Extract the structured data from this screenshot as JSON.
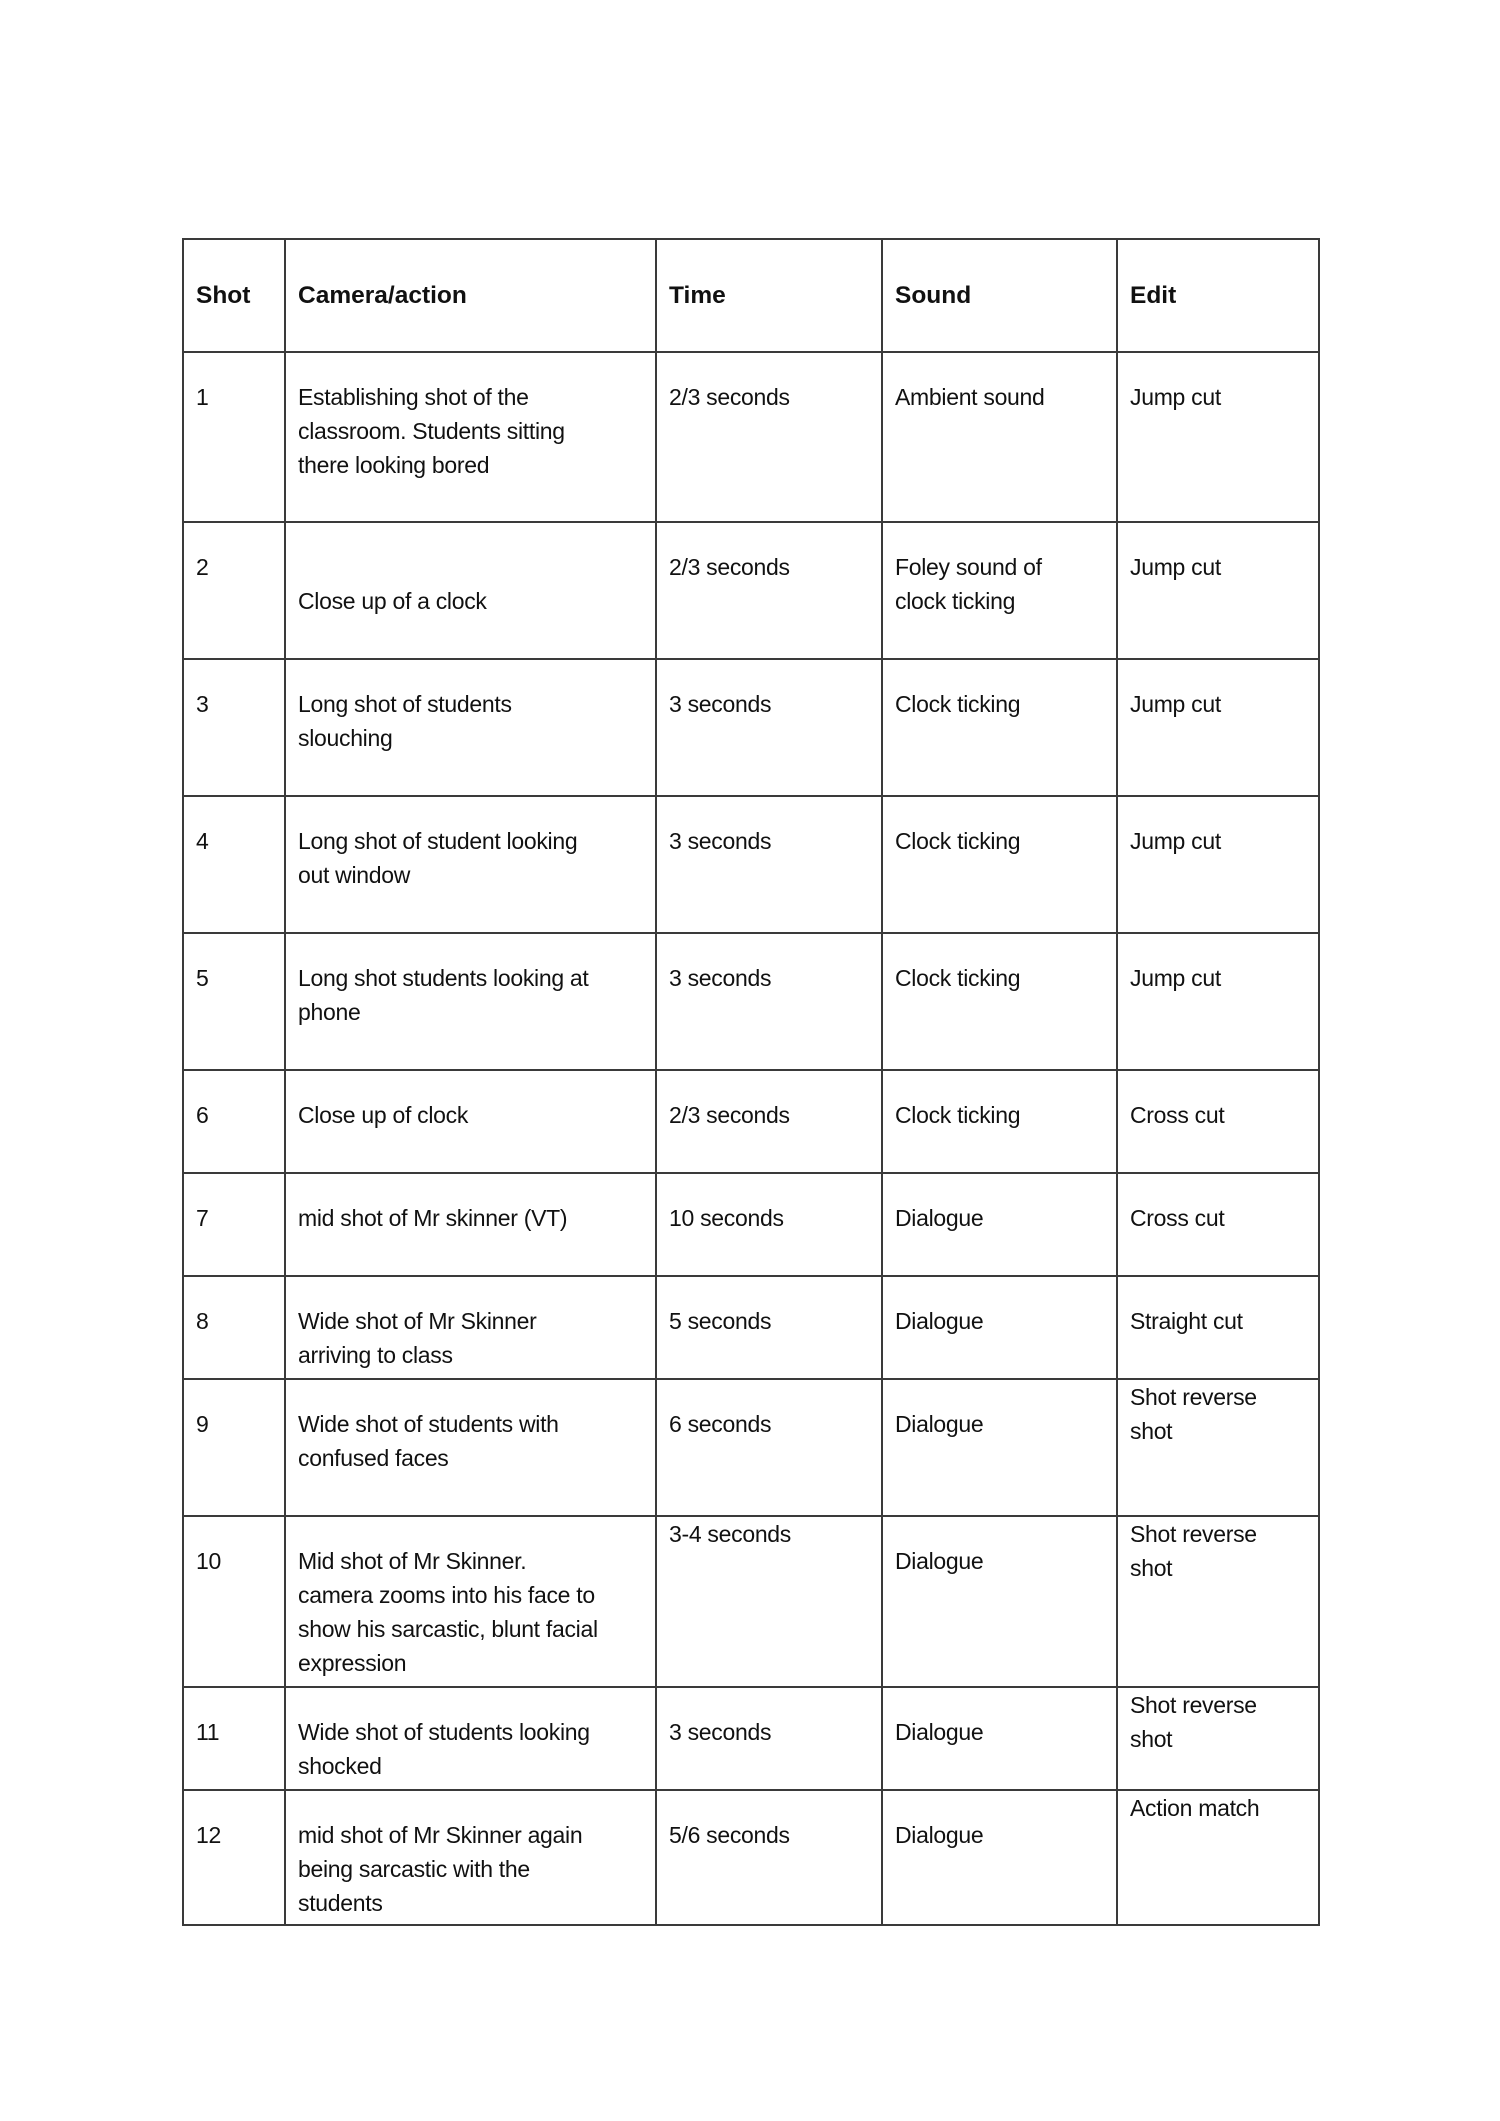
{
  "document": {
    "headers": [
      "Shot",
      "Camera/action",
      "Time",
      "Sound",
      "Edit"
    ],
    "rows": [
      {
        "shot": "1",
        "camera_action": [
          "Establishing shot of the",
          "classroom. Students sitting",
          "there looking bored"
        ],
        "time": [
          "2/3 seconds"
        ],
        "sound": [
          "Ambient sound"
        ],
        "edit": [
          "Jump cut"
        ]
      },
      {
        "shot": "2",
        "camera_action": [
          "Close up of a clock"
        ],
        "time": [
          "2/3 seconds"
        ],
        "sound": [
          "Foley sound of",
          "clock ticking"
        ],
        "edit": [
          "Jump cut"
        ]
      },
      {
        "shot": "3",
        "camera_action": [
          "Long shot of students",
          "slouching"
        ],
        "time": [
          "3 seconds"
        ],
        "sound": [
          "Clock ticking"
        ],
        "edit": [
          "Jump cut"
        ]
      },
      {
        "shot": "4",
        "camera_action": [
          "Long shot of student looking",
          "out window"
        ],
        "time": [
          "3 seconds"
        ],
        "sound": [
          "Clock ticking"
        ],
        "edit": [
          "Jump cut"
        ]
      },
      {
        "shot": "5",
        "camera_action": [
          "Long shot students looking at",
          "phone"
        ],
        "time": [
          "3 seconds"
        ],
        "sound": [
          "Clock ticking"
        ],
        "edit": [
          "Jump cut"
        ]
      },
      {
        "shot": "6",
        "camera_action": [
          "Close up of clock"
        ],
        "time": [
          "2/3 seconds"
        ],
        "sound": [
          "Clock ticking"
        ],
        "edit": [
          "Cross cut"
        ]
      },
      {
        "shot": "7",
        "camera_action": [
          "mid shot of Mr skinner (VT)"
        ],
        "time": [
          "10 seconds"
        ],
        "sound": [
          "Dialogue"
        ],
        "edit": [
          "Cross cut"
        ]
      },
      {
        "shot": "8",
        "camera_action": [
          "Wide shot of Mr Skinner",
          "arriving to class"
        ],
        "time": [
          "5 seconds"
        ],
        "sound": [
          "Dialogue"
        ],
        "edit": [
          "Straight cut"
        ]
      },
      {
        "shot": "9",
        "camera_action": [
          "Wide shot of students with",
          "confused faces"
        ],
        "time": [
          "6 seconds"
        ],
        "sound": [
          "Dialogue"
        ],
        "edit": [
          "Shot reverse",
          "shot"
        ]
      },
      {
        "shot": "10",
        "camera_action": [
          "Mid shot of Mr Skinner.",
          "camera zooms into his face to",
          "show his sarcastic, blunt facial",
          "expression"
        ],
        "time": [
          "3-4 seconds"
        ],
        "sound": [
          "Dialogue"
        ],
        "edit": [
          "Shot reverse",
          "shot"
        ]
      },
      {
        "shot": "11",
        "camera_action": [
          "Wide shot of students looking",
          "shocked"
        ],
        "time": [
          "3 seconds"
        ],
        "sound": [
          "Dialogue"
        ],
        "edit": [
          "Shot reverse",
          "shot"
        ]
      },
      {
        "shot": "12",
        "camera_action": [
          "mid shot of Mr Skinner again",
          "being sarcastic with the",
          "students"
        ],
        "time": [
          "5/6 seconds"
        ],
        "sound": [
          "Dialogue"
        ],
        "edit": [
          "Action match"
        ]
      }
    ]
  }
}
